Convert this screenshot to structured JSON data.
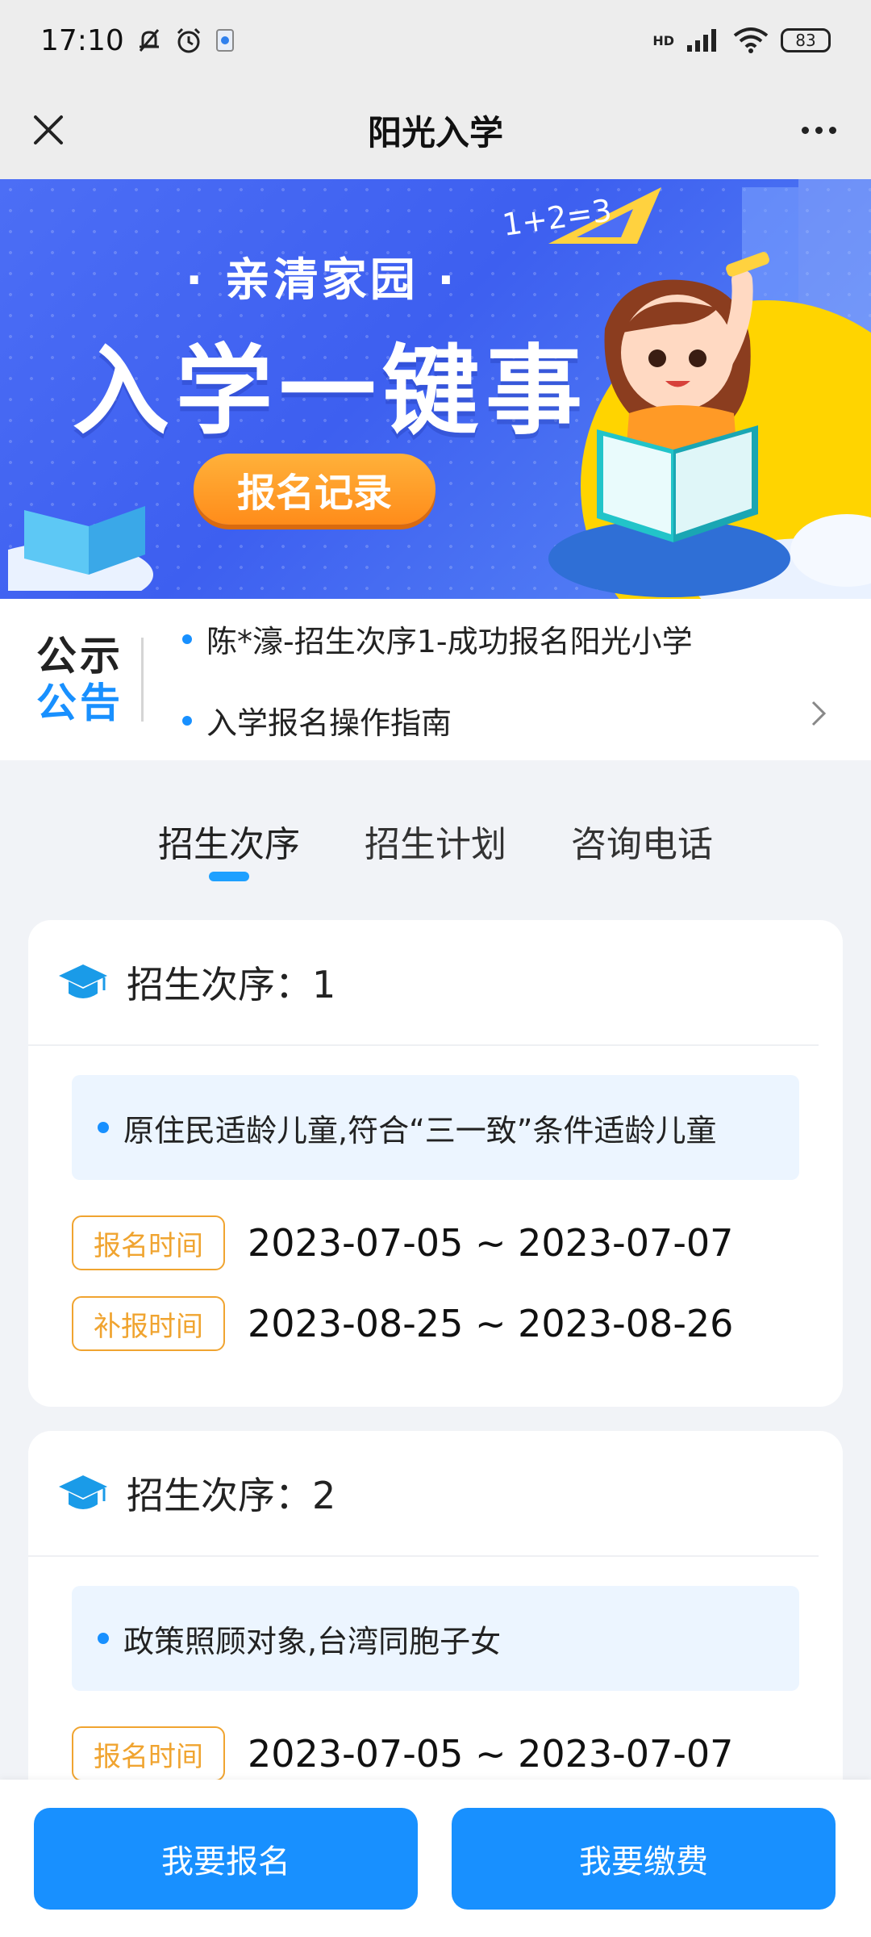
{
  "status_bar": {
    "time": "17:10",
    "battery": "83",
    "network": "HD",
    "icons": [
      "bell-off-icon",
      "alarm-icon",
      "app-notification-icon",
      "signal-icon",
      "wifi-icon",
      "battery-icon"
    ]
  },
  "nav": {
    "title": "阳光入学",
    "close_icon": "close-icon",
    "more_icon": "more-icon"
  },
  "banner": {
    "subtitle": "· 亲清家园 ·",
    "title": "入学一键事",
    "button": "报名记录",
    "math_text": "1+2=3"
  },
  "notice": {
    "logo_line1": "公示",
    "logo_line2": "公告",
    "items": [
      "陈*濠-招生次序1-成功报名阳光小学",
      "入学报名操作指南"
    ]
  },
  "tabs": [
    {
      "label": "招生次序",
      "active": true
    },
    {
      "label": "招生计划",
      "active": false
    },
    {
      "label": "咨询电话",
      "active": false
    }
  ],
  "cards": [
    {
      "title": "招生次序：1",
      "criteria": "原住民适龄儿童,符合“三一致”条件适龄儿童",
      "times": [
        {
          "label": "报名时间",
          "value": "2023-07-05 ~ 2023-07-07"
        },
        {
          "label": "补报时间",
          "value": "2023-08-25 ~ 2023-08-26"
        }
      ]
    },
    {
      "title": "招生次序：2",
      "criteria": "政策照顾对象,台湾同胞子女",
      "times": [
        {
          "label": "报名时间",
          "value": "2023-07-05 ~ 2023-07-07"
        }
      ]
    }
  ],
  "actions": {
    "register": "我要报名",
    "pay": "我要缴费"
  },
  "colors": {
    "accent": "#1890ff",
    "badge": "#f0a430",
    "banner": "#4c6ef5",
    "banner_button": "#ff9a26"
  }
}
